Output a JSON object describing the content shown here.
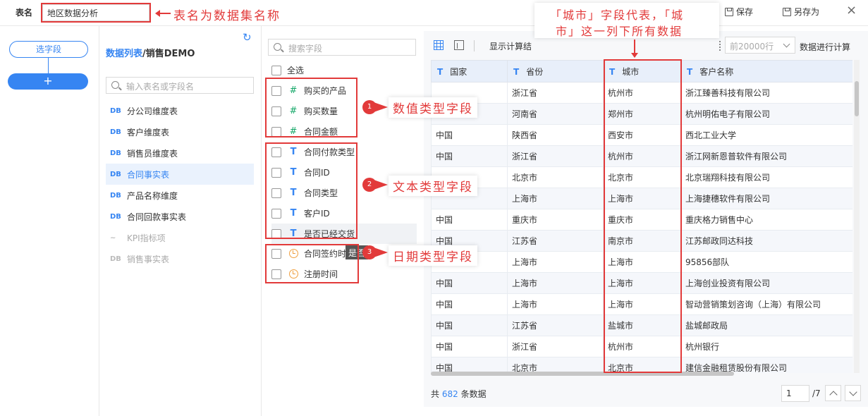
{
  "topbar": {
    "table_name_label": "表名",
    "table_name_value": "地区数据分析",
    "save_label": "保存",
    "save_as_label": "另存为",
    "close_glyph": "×"
  },
  "left": {
    "pick_field_label": "选字段",
    "add_label": "+"
  },
  "tables": {
    "crumb_link": "数据列表",
    "crumb_rest": "/销售DEMO",
    "search_placeholder": "输入表名或字段名",
    "items": [
      {
        "tag": "DB",
        "label": "分公司维度表"
      },
      {
        "tag": "DB",
        "label": "客户维度表"
      },
      {
        "tag": "DB",
        "label": "销售员维度表"
      },
      {
        "tag": "DB",
        "label": "合同事实表"
      },
      {
        "tag": "DB",
        "label": "产品名称维度"
      },
      {
        "tag": "DB",
        "label": "合同回款事实表"
      },
      {
        "tag": "~",
        "label": "KPI指标项"
      },
      {
        "tag": "DB",
        "label": "销售事实表"
      }
    ]
  },
  "fields": {
    "search_placeholder": "搜索字段",
    "select_all": "全选",
    "items": [
      {
        "type": "#",
        "label": "购买的产品"
      },
      {
        "type": "#",
        "label": "购买数量"
      },
      {
        "type": "#",
        "label": "合同金额"
      },
      {
        "type": "T",
        "label": "合同付款类型"
      },
      {
        "type": "T",
        "label": "合同ID"
      },
      {
        "type": "T",
        "label": "合同类型"
      },
      {
        "type": "T",
        "label": "客户ID"
      },
      {
        "type": "T",
        "label": "是否已经交货"
      },
      {
        "type": "date",
        "label": "合同签约时间"
      },
      {
        "type": "date",
        "label": "注册时间"
      }
    ],
    "tooltip": "是否"
  },
  "preview": {
    "calc_label": "显示计算结",
    "rows_select": "前20000行",
    "rows_suffix": "数据进行计算",
    "columns": [
      "国家",
      "省份",
      "城市",
      "客户名称"
    ],
    "rows": [
      [
        "",
        "浙江省",
        "杭州市",
        "浙江臻善科技有限公司"
      ],
      [
        "",
        "河南省",
        "郑州市",
        "杭州明佑电子有限公司"
      ],
      [
        "中国",
        "陕西省",
        "西安市",
        "西北工业大学"
      ],
      [
        "中国",
        "浙江省",
        "杭州市",
        "浙江网新恩普软件有限公司"
      ],
      [
        "",
        "北京市",
        "北京市",
        "北京瑞翔科技有限公司"
      ],
      [
        "",
        "上海市",
        "上海市",
        "上海捷穗软件有限公司"
      ],
      [
        "中国",
        "重庆市",
        "重庆市",
        "重庆格力销售中心"
      ],
      [
        "中国",
        "江苏省",
        "南京市",
        "江苏邮政同达科技"
      ],
      [
        "",
        "上海市",
        "上海市",
        "95856部队"
      ],
      [
        "中国",
        "上海市",
        "上海市",
        "上海创业投资有限公司"
      ],
      [
        "中国",
        "上海市",
        "上海市",
        "智动营销策划咨询（上海）有限公司"
      ],
      [
        "中国",
        "江苏省",
        "盐城市",
        "盐城邮政局"
      ],
      [
        "中国",
        "浙江省",
        "杭州市",
        "杭州银行"
      ],
      [
        "中国",
        "北京市",
        "北京市",
        "建信金融租赁股份有限公司"
      ]
    ],
    "footer_prefix": "共",
    "footer_count": "682",
    "footer_suffix": "条数据",
    "page_value": "1",
    "page_total": "/7"
  },
  "annotations": {
    "table_name_note": "表名为数据集名称",
    "city_note_line1": "「城市」字段代表，「城",
    "city_note_line2": "市」这一列下所有数据",
    "badge1": "1",
    "badge2": "2",
    "badge3": "3",
    "numeric_note": "数值类型字段",
    "text_note": "文本类型字段",
    "date_note": "日期类型字段"
  },
  "colors": {
    "accent": "#3685f2",
    "annotation": "#e23a3a",
    "numeric_icon": "#17a86a",
    "date_icon": "#f0a040"
  }
}
